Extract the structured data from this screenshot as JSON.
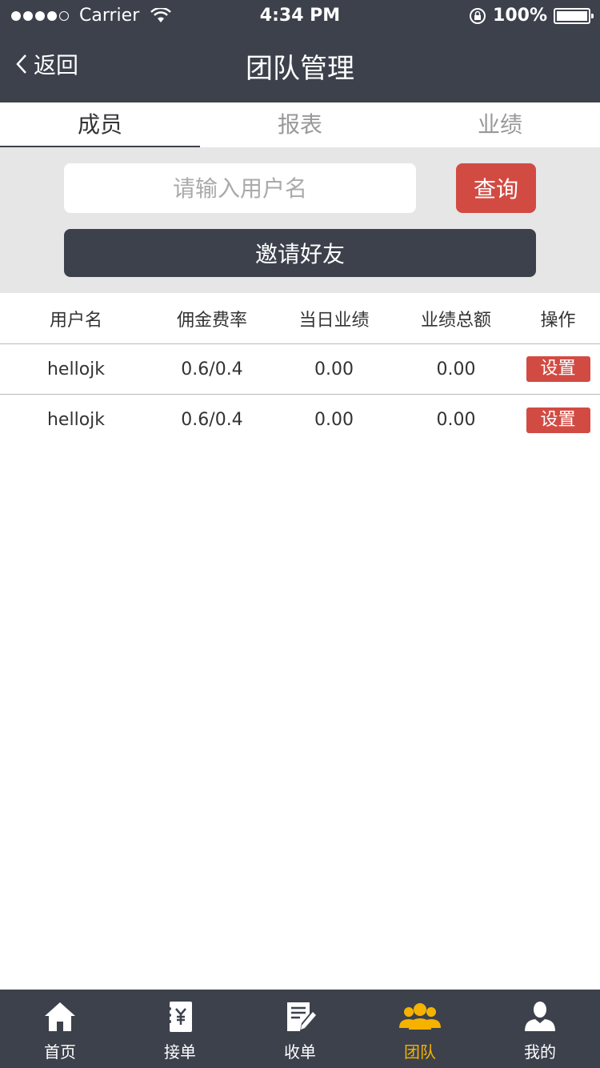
{
  "status_bar": {
    "carrier": "Carrier",
    "time": "4:34 PM",
    "battery": "100%"
  },
  "nav": {
    "back_label": "返回",
    "title": "团队管理"
  },
  "tabs": [
    {
      "label": "成员",
      "active": true
    },
    {
      "label": "报表",
      "active": false
    },
    {
      "label": "业绩",
      "active": false
    }
  ],
  "search": {
    "placeholder": "请输入用户名",
    "value": "",
    "query_label": "查询",
    "invite_label": "邀请好友"
  },
  "table": {
    "headers": [
      "用户名",
      "佣金费率",
      "当日业绩",
      "业绩总额",
      "操作"
    ],
    "rows": [
      {
        "username": "hellojk",
        "rate": "0.6/0.4",
        "today": "0.00",
        "total": "0.00",
        "action": "设置"
      },
      {
        "username": "hellojk",
        "rate": "0.6/0.4",
        "today": "0.00",
        "total": "0.00",
        "action": "设置"
      }
    ]
  },
  "bottom_tabs": [
    {
      "label": "首页",
      "icon": "home-icon",
      "active": false
    },
    {
      "label": "接单",
      "icon": "order-receipt-icon",
      "active": false
    },
    {
      "label": "收单",
      "icon": "edit-document-icon",
      "active": false
    },
    {
      "label": "团队",
      "icon": "team-icon",
      "active": true
    },
    {
      "label": "我的",
      "icon": "user-icon",
      "active": false
    }
  ],
  "colors": {
    "header_bg": "#3c414c",
    "accent_red": "#d24b43",
    "active_tab_yellow": "#f5b300",
    "search_area_bg": "#e6e6e6"
  }
}
